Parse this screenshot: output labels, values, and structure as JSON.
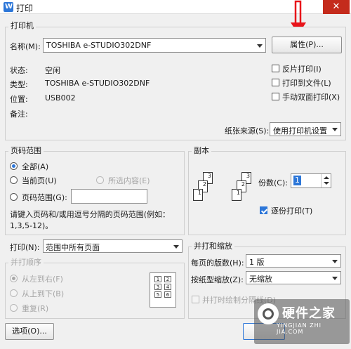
{
  "window": {
    "title": "打印",
    "app_icon_text": "W"
  },
  "printer": {
    "group_title": "打印机",
    "name_label": "名称(M):",
    "name_value": "TOSHIBA e-STUDIO302DNF",
    "properties_button": "属性(P)...",
    "status_label": "状态:",
    "status_value": "空闲",
    "type_label": "类型:",
    "type_value": "TOSHIBA e-STUDIO302DNF",
    "location_label": "位置:",
    "location_value": "USB002",
    "comment_label": "备注:",
    "reverse_print": "反片打印(I)",
    "print_to_file": "打印到文件(L)",
    "manual_duplex": "手动双面打印(X)",
    "paper_source_label": "纸张来源(S):",
    "paper_source_value": "使用打印机设置"
  },
  "page_range": {
    "group_title": "页码范围",
    "all": "全部(A)",
    "current_page": "当前页(U)",
    "selection": "所选内容(E)",
    "range": "页码范围(G):",
    "range_value": "",
    "hint_line1": "请键入页码和/或用逗号分隔的页码范围(例如：",
    "hint_line2": "1,3,5-12)。"
  },
  "copies": {
    "group_title": "副本",
    "count_label": "份数(C):",
    "count_value": "1",
    "collate": "逐份打印(T)"
  },
  "print_what": {
    "label": "打印(N):",
    "value": "范围中所有页面"
  },
  "print_order": {
    "group_title": "并打顺序",
    "left_to_right": "从左到右(F)",
    "top_to_bottom": "从上到下(B)",
    "repeat": "重复(R)"
  },
  "zoom": {
    "group_title": "并打和缩放",
    "pages_per_sheet_label": "每页的版数(H):",
    "pages_per_sheet_value": "1 版",
    "scale_label": "按纸型缩放(Z):",
    "scale_value": "无缩放",
    "draw_lines": "并打时绘制分隔线(D)"
  },
  "footer": {
    "options_button": "选项(O)...",
    "watermark_name": "硬件之家",
    "watermark_url": "YINGJIAN ZHI JIA.COM"
  },
  "colors": {
    "accent": "#2c76d8",
    "annotation_arrow": "#e8141a",
    "close": "#c42b1c"
  }
}
